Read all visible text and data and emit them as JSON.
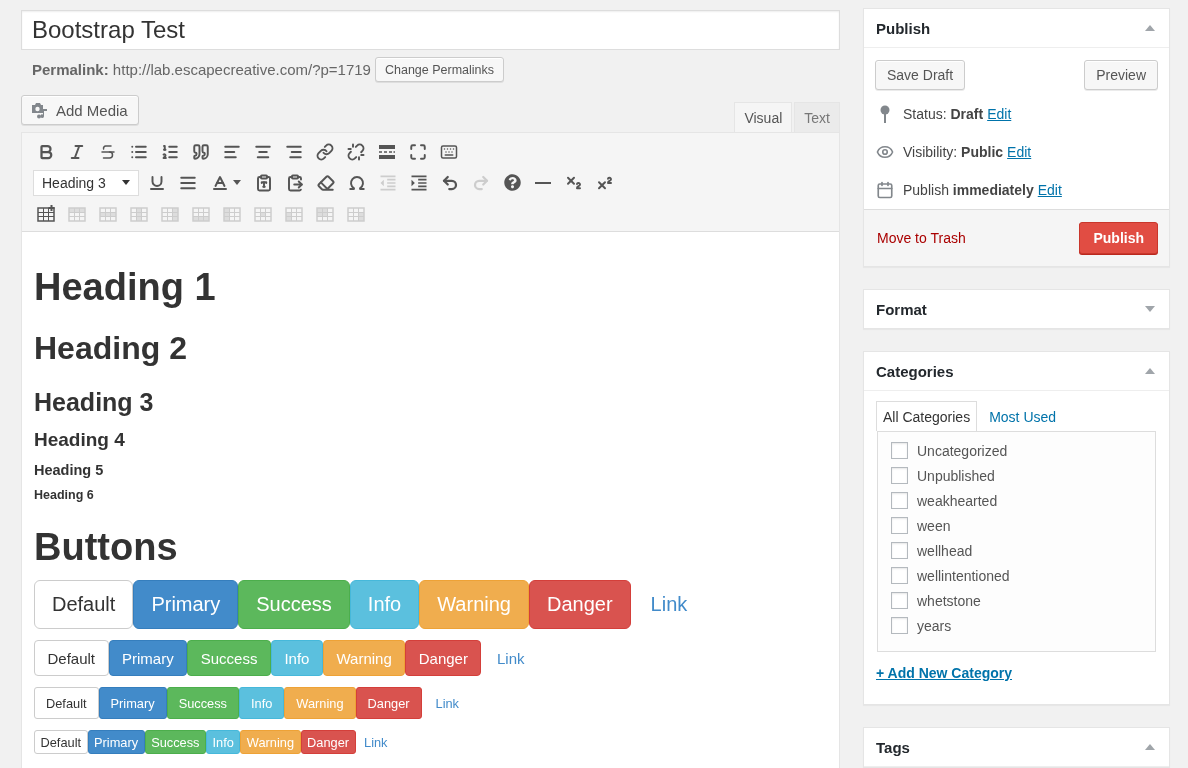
{
  "title_field": {
    "value": "Bootstrap Test"
  },
  "permalink": {
    "text": "**Permalink:** http://lab.escapecreative.com/?p=1719",
    "button": "Change Permalinks"
  },
  "add_media_button": {
    "label": "Add Media"
  },
  "editor": {
    "tabs": [
      {
        "label": "Visual",
        "selected": true
      },
      {
        "label": "Text",
        "selected": false
      }
    ],
    "toolbar": [
      {
        "items": [
          {
            "kind": "button",
            "disabled": false
          },
          {
            "kind": "button",
            "disabled": false
          },
          {
            "kind": "button",
            "disabled": false
          },
          {
            "kind": "button",
            "disabled": false
          },
          {
            "kind": "button",
            "disabled": false
          },
          {
            "kind": "button",
            "disabled": false
          },
          {
            "kind": "button",
            "disabled": false
          },
          {
            "kind": "button",
            "disabled": false
          },
          {
            "kind": "button",
            "disabled": false
          },
          {
            "kind": "button",
            "disabled": false
          },
          {
            "kind": "button",
            "disabled": false
          },
          {
            "kind": "button",
            "disabled": false
          },
          {
            "kind": "button",
            "disabled": false
          },
          {
            "kind": "button",
            "disabled": false
          }
        ]
      },
      {
        "items": [
          {
            "kind": "select",
            "value": "Heading 3"
          },
          {
            "kind": "button",
            "disabled": false
          },
          {
            "kind": "button",
            "disabled": false
          },
          {
            "kind": "split",
            "disabled": false
          },
          {
            "kind": "button",
            "disabled": false
          },
          {
            "kind": "button",
            "disabled": false
          },
          {
            "kind": "button",
            "disabled": false
          },
          {
            "kind": "button",
            "disabled": false
          },
          {
            "kind": "button",
            "disabled": true
          },
          {
            "kind": "button",
            "disabled": false
          },
          {
            "kind": "button",
            "disabled": false
          },
          {
            "kind": "button",
            "disabled": true
          },
          {
            "kind": "button",
            "disabled": false
          },
          {
            "kind": "button",
            "disabled": false
          },
          {
            "kind": "button",
            "disabled": false
          },
          {
            "kind": "button",
            "disabled": false
          }
        ]
      },
      {
        "items": [
          {
            "kind": "button",
            "disabled": false
          },
          {
            "kind": "button",
            "disabled": true
          },
          {
            "kind": "button",
            "disabled": true
          },
          {
            "kind": "button",
            "disabled": true
          },
          {
            "kind": "button",
            "disabled": true
          },
          {
            "kind": "button",
            "disabled": true
          },
          {
            "kind": "button",
            "disabled": true
          },
          {
            "kind": "button",
            "disabled": true
          },
          {
            "kind": "button",
            "disabled": true
          },
          {
            "kind": "button",
            "disabled": true
          },
          {
            "kind": "button",
            "disabled": true
          }
        ]
      }
    ],
    "content": [
      {
        "kind": "h1",
        "text": "Heading 1"
      },
      {
        "kind": "h2",
        "text": "Heading 2"
      },
      {
        "kind": "h3",
        "text": "Heading 3"
      },
      {
        "kind": "h4",
        "text": "Heading 4"
      },
      {
        "kind": "h5",
        "text": "Heading 5"
      },
      {
        "kind": "h6",
        "text": "Heading 6"
      },
      {
        "kind": "h1",
        "text": "Buttons"
      },
      {
        "kind": "large",
        "buttons": [
          {
            "kind": "default",
            "label": "Default"
          },
          {
            "kind": "primary",
            "label": "Primary"
          },
          {
            "kind": "success",
            "label": "Success"
          },
          {
            "kind": "info",
            "label": "Info"
          },
          {
            "kind": "warning",
            "label": "Warning"
          },
          {
            "kind": "danger",
            "label": "Danger"
          },
          {
            "kind": "link",
            "label": "Link"
          }
        ]
      },
      {
        "kind": "regular",
        "buttons": [
          {
            "kind": "default",
            "label": "Default"
          },
          {
            "kind": "primary",
            "label": "Primary"
          },
          {
            "kind": "success",
            "label": "Success"
          },
          {
            "kind": "info",
            "label": "Info"
          },
          {
            "kind": "warning",
            "label": "Warning"
          },
          {
            "kind": "danger",
            "label": "Danger"
          },
          {
            "kind": "link",
            "label": "Link"
          }
        ]
      },
      {
        "kind": "small",
        "buttons": [
          {
            "kind": "default",
            "label": "Default"
          },
          {
            "kind": "primary",
            "label": "Primary"
          },
          {
            "kind": "success",
            "label": "Success"
          },
          {
            "kind": "info",
            "label": "Info"
          },
          {
            "kind": "warning",
            "label": "Warning"
          },
          {
            "kind": "danger",
            "label": "Danger"
          },
          {
            "kind": "link",
            "label": "Link"
          }
        ]
      },
      {
        "kind": "mini",
        "buttons": [
          {
            "kind": "default",
            "label": "Default"
          },
          {
            "kind": "primary",
            "label": "Primary"
          },
          {
            "kind": "success",
            "label": "Success"
          },
          {
            "kind": "info",
            "label": "Info"
          },
          {
            "kind": "warning",
            "label": "Warning"
          },
          {
            "kind": "danger",
            "label": "Danger"
          },
          {
            "kind": "link",
            "label": "Link"
          }
        ]
      }
    ]
  },
  "sidebar": [
    {
      "kind": "publish",
      "title": "Publish",
      "expanded": true,
      "actions": [
        {
          "label": "Save Draft"
        },
        {
          "label": "Preview"
        }
      ],
      "rows": [
        {
          "kind": "status",
          "text": "Status: **Draft**",
          "link": "Edit"
        },
        {
          "kind": "visibility",
          "text": "Visibility: **Public**",
          "link": "Edit"
        },
        {
          "kind": "schedule",
          "text": "Publish **immediately**",
          "link": "Edit"
        }
      ],
      "trash_link": "Move to Trash",
      "publish_button": "Publish"
    },
    {
      "kind": "format",
      "title": "Format",
      "expanded": false
    },
    {
      "kind": "categories",
      "title": "Categories",
      "expanded": true,
      "tabs": [
        {
          "label": "All Categories",
          "selected": true
        },
        {
          "label": "Most Used",
          "selected": false
        }
      ],
      "items": [
        {
          "label": "Uncategorized",
          "checked": false
        },
        {
          "label": "Unpublished",
          "checked": false
        },
        {
          "label": "weakhearted",
          "checked": false
        },
        {
          "label": "ween",
          "checked": false
        },
        {
          "label": "wellhead",
          "checked": false
        },
        {
          "label": "wellintentioned",
          "checked": false
        },
        {
          "label": "whetstone",
          "checked": false
        },
        {
          "label": "years",
          "checked": false
        }
      ],
      "add_link": "+ Add New Category"
    },
    {
      "kind": "tags",
      "title": "Tags",
      "expanded": true
    }
  ]
}
